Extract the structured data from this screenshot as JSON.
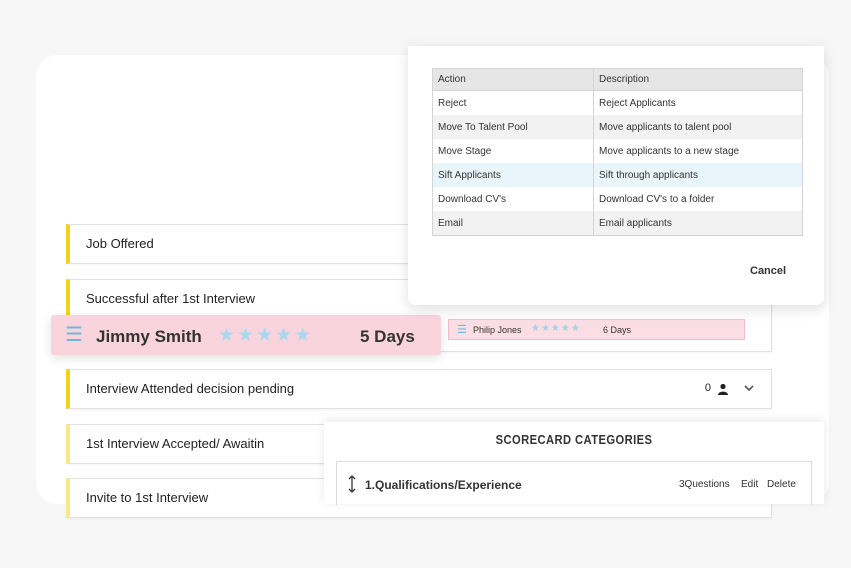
{
  "pipeline": {
    "stages": [
      {
        "label": "Job Offered"
      },
      {
        "label": "Successful after 1st Interview"
      },
      {
        "label": "Interview Attended decision pending",
        "count": "0"
      },
      {
        "label": "1st Interview Accepted/ Awaitin"
      },
      {
        "label": "Invite to 1st Interview"
      }
    ]
  },
  "candidates": {
    "dragging": {
      "name": "Jimmy Smith",
      "rating": 5,
      "stars": "★★★★★",
      "days": "5 Days"
    },
    "listed": {
      "name": "Philip Jones",
      "rating": 5,
      "stars": "★★★★★",
      "days": "6 Days"
    }
  },
  "actions_modal": {
    "columns": [
      "Action",
      "Description"
    ],
    "rows": [
      [
        "Reject",
        "Reject Applicants"
      ],
      [
        "Move To Talent Pool",
        "Move applicants to talent pool"
      ],
      [
        "Move Stage",
        "Move applicants to a new stage"
      ],
      [
        "Sift Applicants",
        "Sift through applicants"
      ],
      [
        "Download CV's",
        "Download CV's to a folder"
      ],
      [
        "Email",
        "Email applicants"
      ]
    ],
    "cancel_label": "Cancel"
  },
  "scorecard": {
    "title": "SCORECARD CATEGORIES",
    "categories": [
      {
        "title": "1.Qualifications/Experience",
        "questions": "3Questions",
        "edit_label": "Edit",
        "delete_label": "Delete"
      }
    ]
  },
  "colors": {
    "stage_accent": "#f2d31b",
    "candidate_pink": "#f9d4dd",
    "star_blue": "#a9d8ee",
    "row_highlight": "#e8f5fb"
  },
  "icons": [
    "menu-icon",
    "star-icon",
    "person-icon",
    "chevron-down-icon",
    "drag-handle-icon"
  ]
}
